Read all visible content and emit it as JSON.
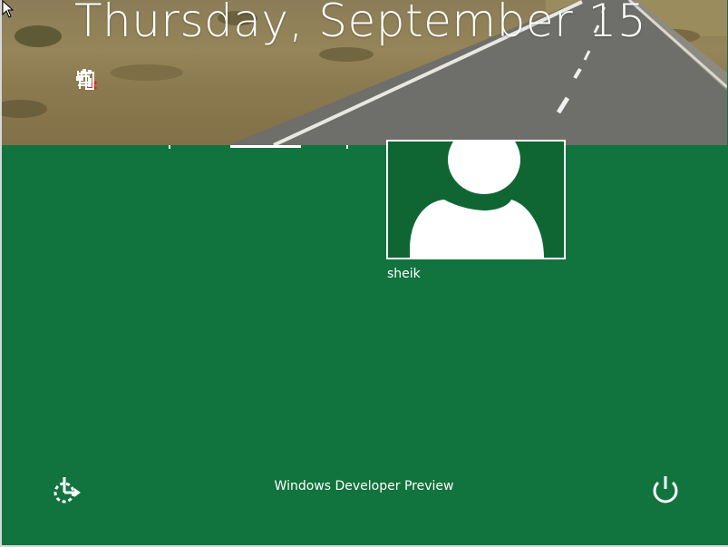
{
  "lock_screen": {
    "date": "Thursday, September 15",
    "status_icons": [
      "network-disconnected-icon",
      "battery-charging-icon"
    ]
  },
  "user": {
    "name": "sheik",
    "avatar_icon": "user-avatar-icon"
  },
  "footer": {
    "edition": "Windows Developer Preview",
    "ease_of_access_icon": "ease-of-access-icon",
    "power_icon": "power-icon"
  },
  "colors": {
    "background": "#11733d",
    "tile_background": "#0f6632",
    "text": "#ffffff"
  }
}
